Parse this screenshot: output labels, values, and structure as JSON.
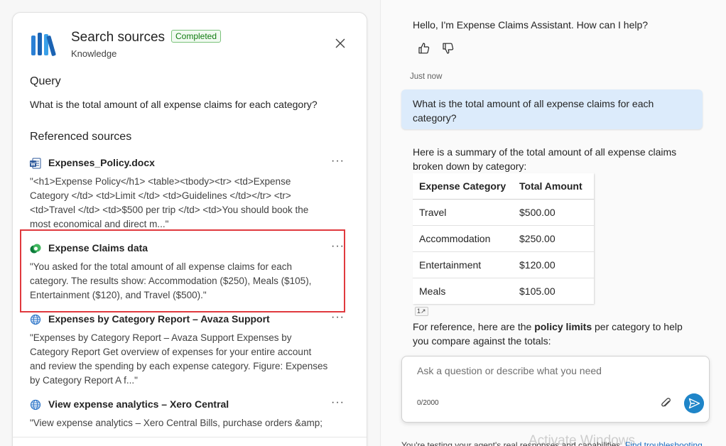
{
  "panel": {
    "title": "Search sources",
    "status": "Completed",
    "subtitle": "Knowledge",
    "query_heading": "Query",
    "query_text": "What is the total amount of all expense claims for each category?",
    "sources_heading": "Referenced sources",
    "more_label": "···",
    "sources": [
      {
        "name": "Expenses_Policy.docx",
        "icon": "word-doc-icon",
        "snippet": "\"<h1>Expense Policy</h1> <table><tbody><tr> <td>Expense Category </td> <td>Limit </td> <td>Guidelines </td></tr> <tr> <td>Travel </td> <td>$500 per trip </td> <td>You should book the most economical and direct m...\""
      },
      {
        "name": "Expense Claims data",
        "icon": "dataverse-icon",
        "snippet": "\"You asked for the total amount of all expense claims for each category. The results show: Accommodation ($250), Meals ($105), Entertainment ($120), and Travel ($500).\""
      },
      {
        "name": "Expenses by Category Report – Avaza Support",
        "icon": "globe-icon",
        "snippet": "\"Expenses by Category Report – Avaza Support Expenses by Category Report Get overview of expenses for your entire account and review the spending by each expense category. Figure: Expenses by Category Report A f...\""
      },
      {
        "name": "View expense analytics – Xero Central",
        "icon": "globe-icon",
        "snippet": "\"View expense analytics – Xero Central Bills, purchase orders &amp;"
      }
    ]
  },
  "chat": {
    "greeting": "Hello, I'm Expense Claims Assistant. How can I help?",
    "timestamp": "Just now",
    "user_message": "What is the total amount of all expense claims for each category?",
    "bot_intro": "Here is a summary of the total amount of all expense claims broken down by category:",
    "table": {
      "headers": [
        "Expense Category",
        "Total Amount"
      ],
      "rows": [
        [
          "Travel",
          "$500.00"
        ],
        [
          "Accommodation",
          "$250.00"
        ],
        [
          "Entertainment",
          "$120.00"
        ],
        [
          "Meals",
          "$105.00"
        ]
      ]
    },
    "citation": "1",
    "reference_prefix": "For reference, here are the ",
    "reference_bold": "policy limits",
    "reference_suffix": " per category to help you compare against the totals:",
    "input_placeholder": "Ask a question or describe what you need",
    "char_count": "0/2000",
    "footer_text": "You're testing your agent's real responses and capabilities. ",
    "footer_link": "Find troubleshooting",
    "watermark": "Activate Windows"
  },
  "colors": {
    "accent": "#1f85c8",
    "user_bubble": "#dcebfb",
    "status_green": "#107c10",
    "highlight_red": "#e0393e"
  }
}
